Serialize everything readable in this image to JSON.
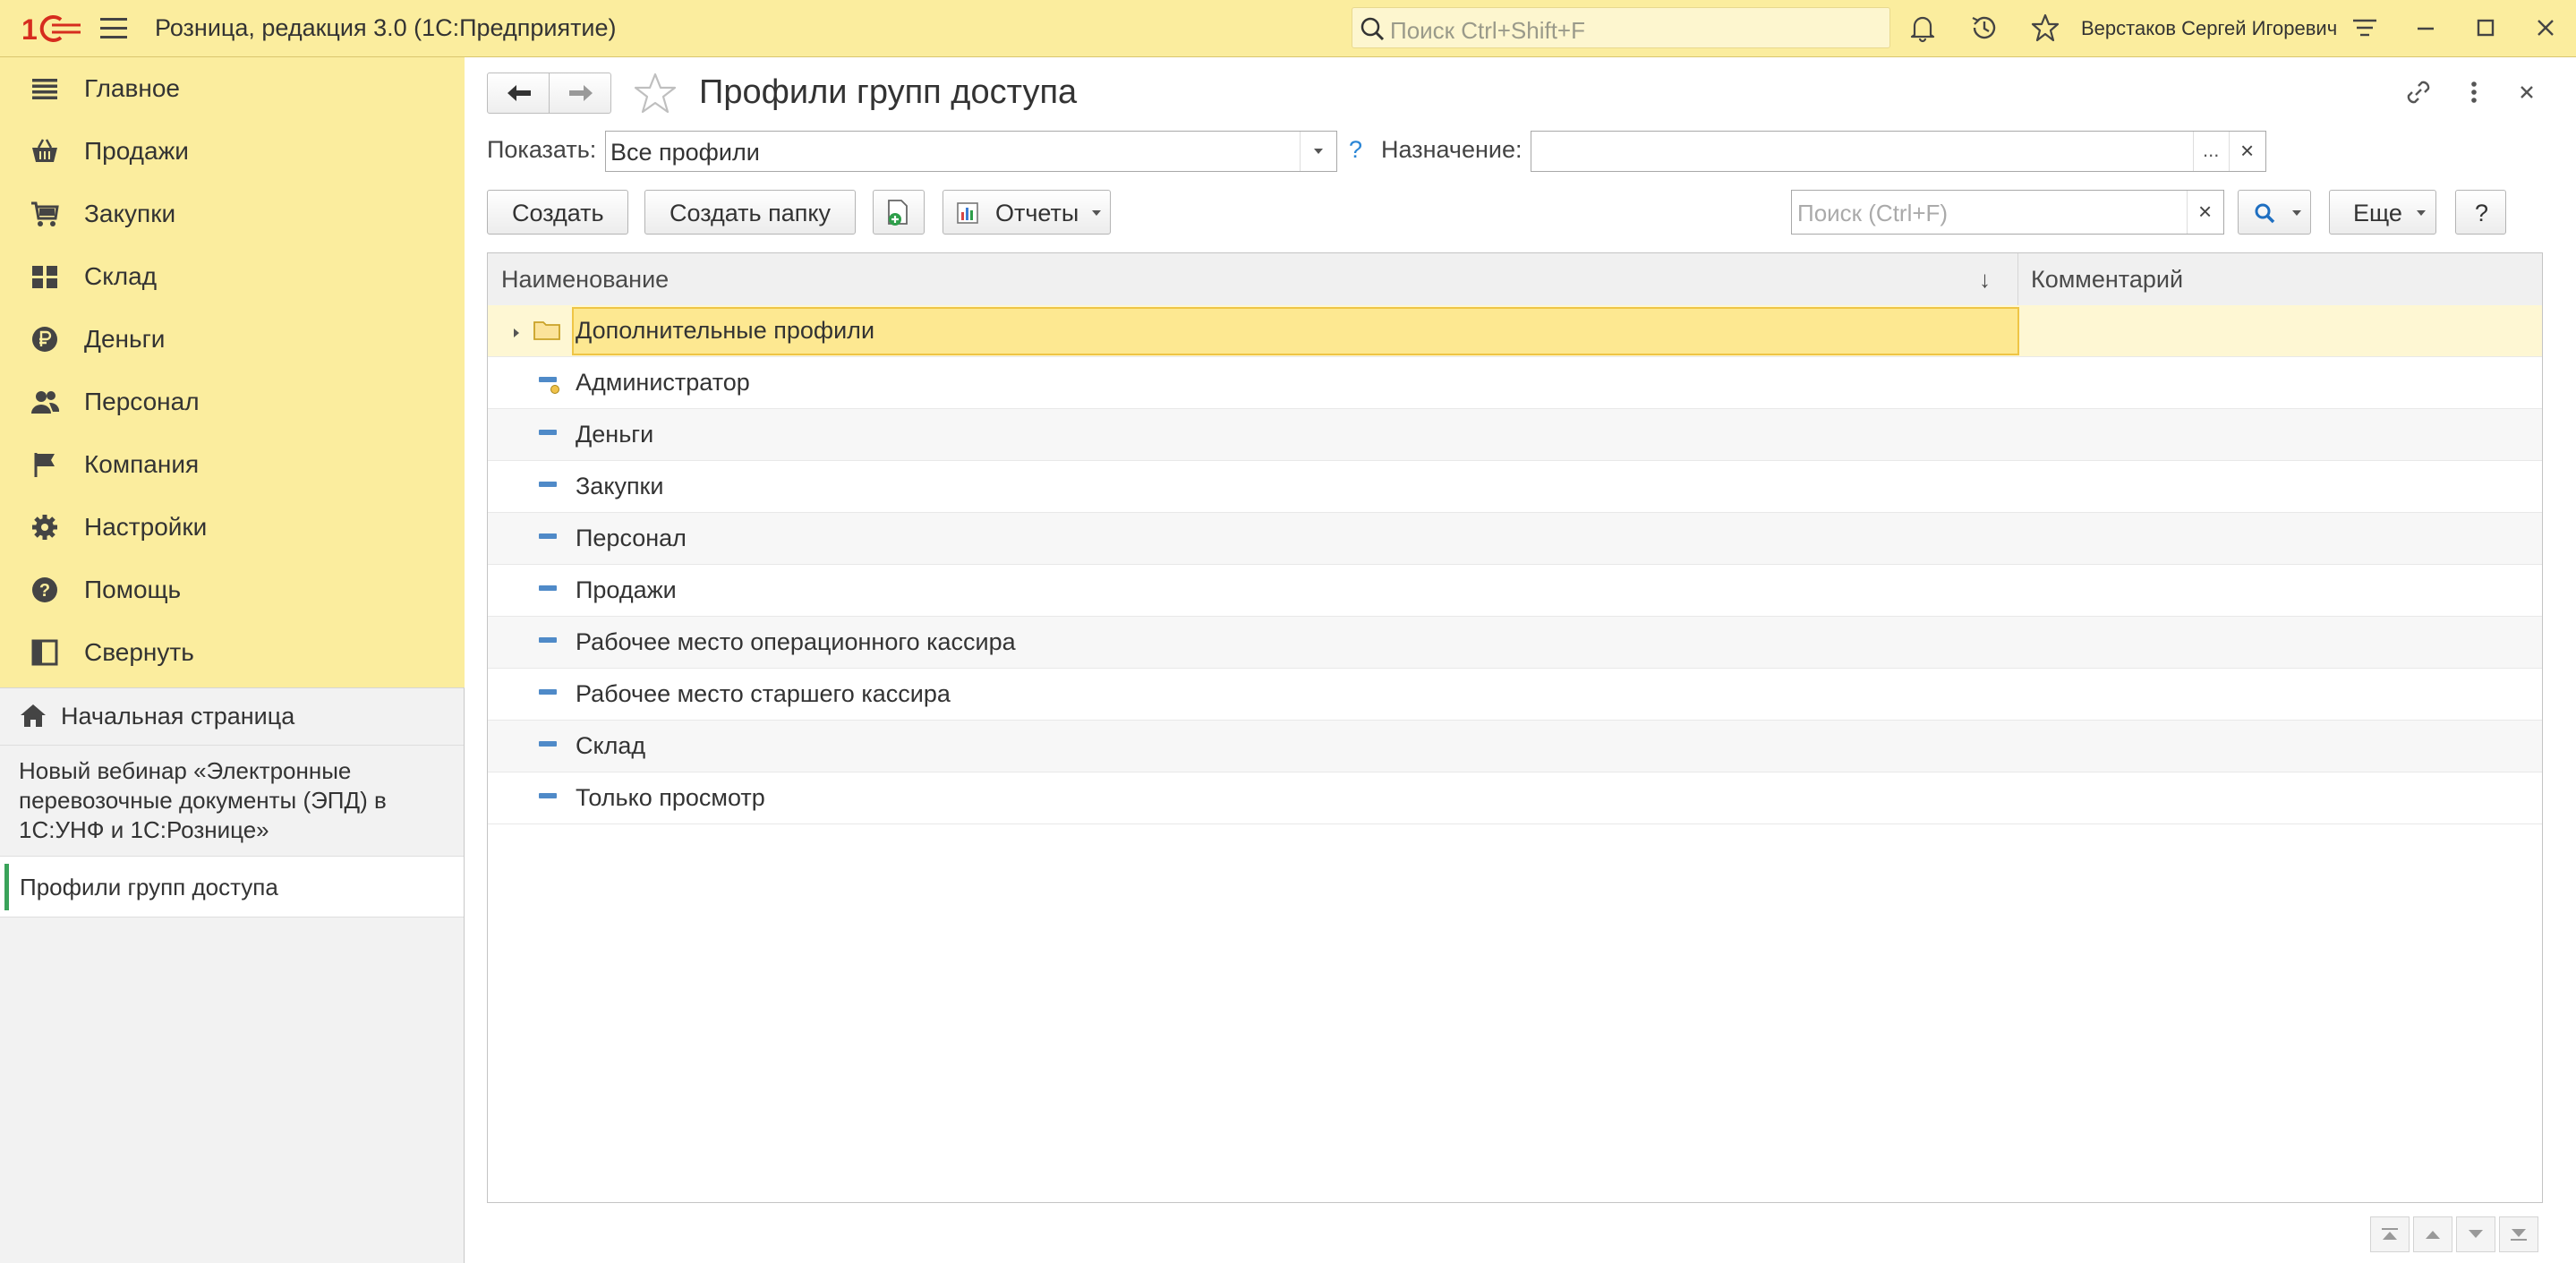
{
  "app": {
    "title": "Розница, редакция 3.0  (1С:Предприятие)",
    "search_placeholder": "Поиск Ctrl+Shift+F",
    "user_name": "Верстаков Сергей Игоревич",
    "accent": "#fbed9e",
    "logo_color": "#d62c1e"
  },
  "sections": [
    {
      "label": "Главное",
      "icon": "list-icon"
    },
    {
      "label": "Продажи",
      "icon": "basket-icon"
    },
    {
      "label": "Закупки",
      "icon": "cart-icon"
    },
    {
      "label": "Склад",
      "icon": "warehouse-icon"
    },
    {
      "label": "Деньги",
      "icon": "ruble-icon"
    },
    {
      "label": "Персонал",
      "icon": "people-icon"
    },
    {
      "label": "Компания",
      "icon": "flag-icon"
    },
    {
      "label": "Настройки",
      "icon": "gear-icon"
    },
    {
      "label": "Помощь",
      "icon": "help-icon"
    },
    {
      "label": "Свернуть",
      "icon": "collapse-icon"
    }
  ],
  "open_windows": {
    "home": "Начальная страница",
    "news": "Новый вебинар «Электронные перевозочные документы (ЭПД) в 1С:УНФ и 1С:Рознице»",
    "active": "Профили групп доступа"
  },
  "form": {
    "title": "Профили групп доступа",
    "show_label": "Показать:",
    "show_value": "Все профили",
    "help_mark": "?",
    "purpose_label": "Назначение:",
    "purpose_value": "",
    "purpose_pick": "...",
    "clear_mark": "×"
  },
  "toolbar": {
    "create": "Создать",
    "create_folder": "Создать папку",
    "reports": "Отчеты",
    "search_placeholder": "Поиск (Ctrl+F)",
    "more": "Еще",
    "help": "?"
  },
  "table": {
    "columns": [
      "Наименование",
      "Комментарий"
    ],
    "sort_mark": "↓",
    "rows": [
      {
        "name": "Дополнительные профили",
        "type": "folder",
        "comment": ""
      },
      {
        "name": "Администратор",
        "type": "predefined-profile",
        "comment": ""
      },
      {
        "name": "Деньги",
        "type": "profile",
        "comment": ""
      },
      {
        "name": "Закупки",
        "type": "profile",
        "comment": ""
      },
      {
        "name": "Персонал",
        "type": "profile",
        "comment": ""
      },
      {
        "name": "Продажи",
        "type": "profile",
        "comment": ""
      },
      {
        "name": "Рабочее место операционного кассира",
        "type": "profile",
        "comment": ""
      },
      {
        "name": "Рабочее место старшего кассира",
        "type": "profile",
        "comment": ""
      },
      {
        "name": "Склад",
        "type": "profile",
        "comment": ""
      },
      {
        "name": "Только просмотр",
        "type": "profile",
        "comment": ""
      }
    ]
  }
}
